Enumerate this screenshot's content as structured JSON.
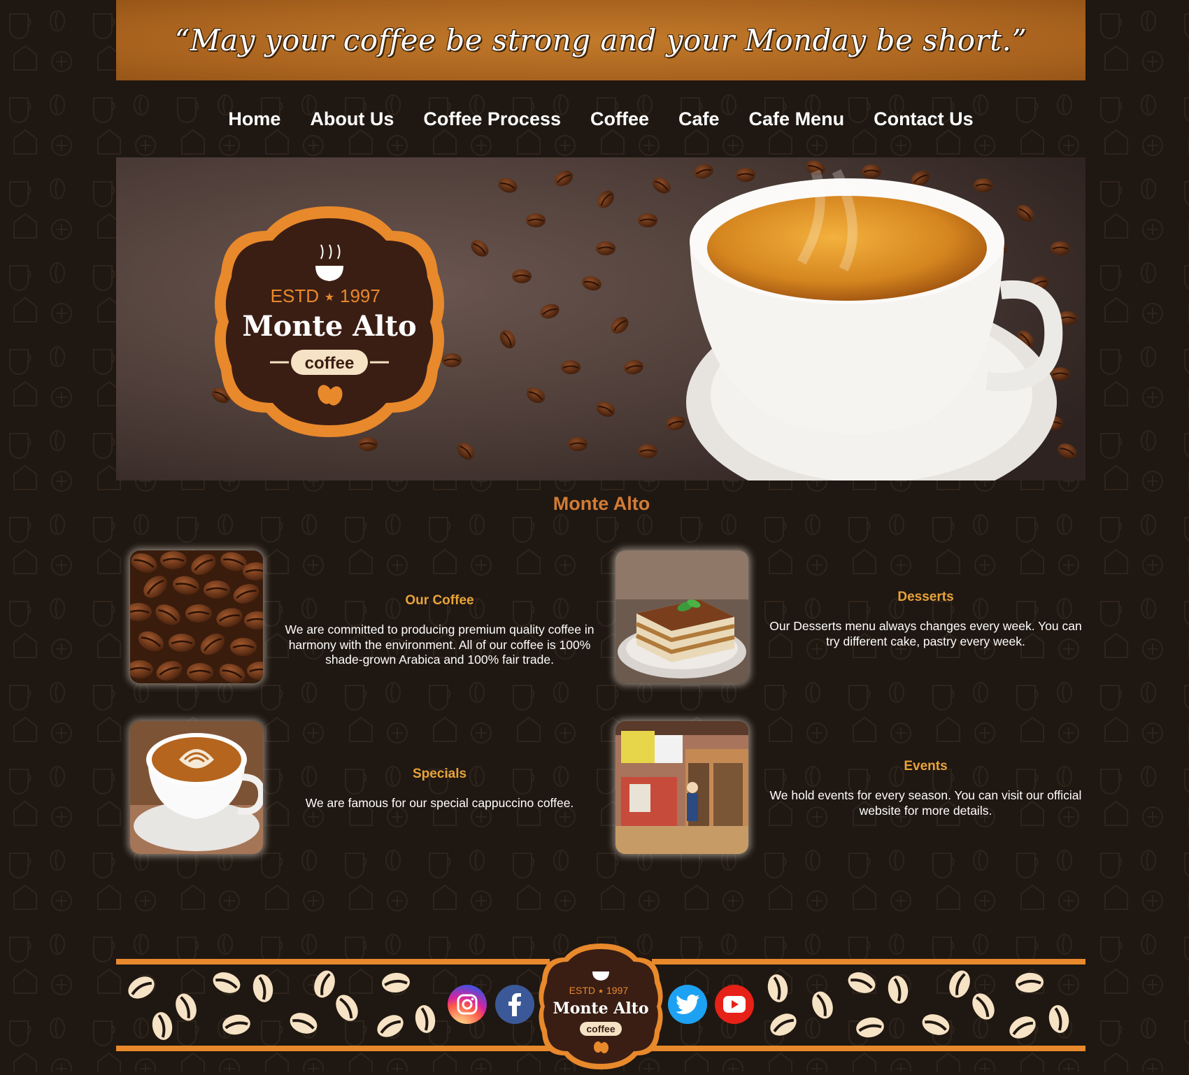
{
  "quote": "“May your coffee be strong and your Monday be short.”",
  "nav": [
    "Home",
    "About Us",
    "Coffee Process",
    "Coffee",
    "Cafe",
    "Cafe Menu",
    "Contact Us"
  ],
  "logo": {
    "estd": "ESTD",
    "year": "1997",
    "name": "Monte Alto",
    "sub": "coffee"
  },
  "section_title": "Monte Alto",
  "cards": [
    {
      "title": "Our Coffee",
      "body": "We are committed to producing premium quality coffee in harmony with the environment. All of our coffee is 100% shade-grown Arabica and 100% fair trade.",
      "image": "coffee-beans"
    },
    {
      "title": "Desserts",
      "body": "Our Desserts menu always changes every week. You can try different cake, pastry every week.",
      "image": "tiramisu"
    },
    {
      "title": "Specials",
      "body": "We are famous for our special cappuccino coffee.",
      "image": "cappuccino"
    },
    {
      "title": "Events",
      "body": "We hold events for every season. You can visit our official website for more details.",
      "image": "cafe-shop"
    }
  ],
  "social": [
    {
      "name": "instagram",
      "icon": "instagram-icon",
      "color": "#d6246e"
    },
    {
      "name": "facebook",
      "icon": "facebook-icon",
      "color": "#3b5998"
    },
    {
      "name": "twitter",
      "icon": "twitter-icon",
      "color": "#1da1f2"
    },
    {
      "name": "youtube",
      "icon": "youtube-icon",
      "color": "#e62117"
    }
  ],
  "colors": {
    "accent": "#d27c35",
    "card_title": "#e8a33a",
    "banner": "#a8621e",
    "background": "#1f1711",
    "footer_line": "#e8892c"
  }
}
